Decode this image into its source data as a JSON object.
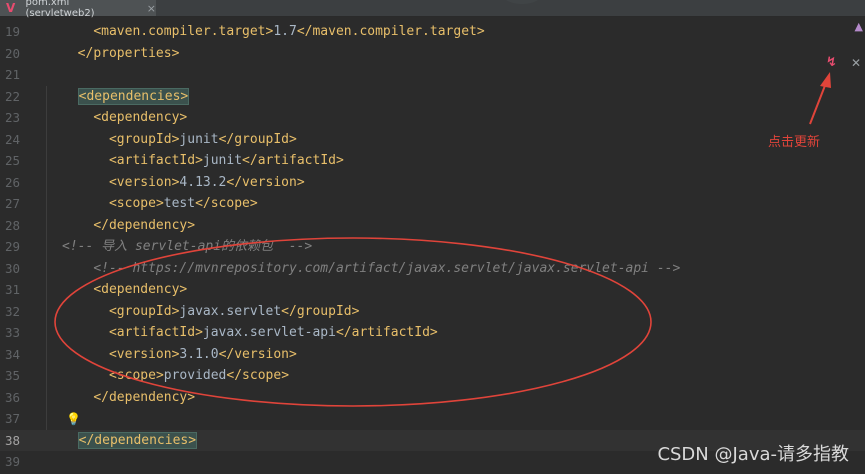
{
  "tab": {
    "title": "pom.xml (servletweb2)",
    "icon": "maven-icon",
    "close": "×"
  },
  "annotation": {
    "label": "点击更新"
  },
  "watermark": "CSDN @Java-请多指教",
  "current_line": 38,
  "lines": [
    {
      "num": "19",
      "parts": [
        {
          "t": "    "
        },
        {
          "c": "tag",
          "t": "<"
        },
        {
          "c": "tn",
          "t": "maven.compiler.target"
        },
        {
          "c": "tag",
          "t": ">"
        },
        {
          "c": "txt",
          "t": "1.7"
        },
        {
          "c": "tag",
          "t": "</"
        },
        {
          "c": "tn",
          "t": "maven.compiler.target"
        },
        {
          "c": "tag",
          "t": ">"
        }
      ]
    },
    {
      "num": "20",
      "parts": [
        {
          "t": "  "
        },
        {
          "c": "tag",
          "t": "</"
        },
        {
          "c": "tn",
          "t": "properties"
        },
        {
          "c": "tag",
          "t": ">"
        }
      ]
    },
    {
      "num": "21",
      "parts": []
    },
    {
      "num": "22",
      "parts": [
        {
          "t": "  "
        },
        {
          "c": "tag hl",
          "t": "<dependencies>"
        }
      ]
    },
    {
      "num": "23",
      "parts": [
        {
          "t": "    "
        },
        {
          "c": "tag",
          "t": "<"
        },
        {
          "c": "tn",
          "t": "dependency"
        },
        {
          "c": "tag",
          "t": ">"
        }
      ]
    },
    {
      "num": "24",
      "parts": [
        {
          "t": "      "
        },
        {
          "c": "tag",
          "t": "<"
        },
        {
          "c": "tn",
          "t": "groupId"
        },
        {
          "c": "tag",
          "t": ">"
        },
        {
          "c": "txt",
          "t": "junit"
        },
        {
          "c": "tag",
          "t": "</"
        },
        {
          "c": "tn",
          "t": "groupId"
        },
        {
          "c": "tag",
          "t": ">"
        }
      ]
    },
    {
      "num": "25",
      "parts": [
        {
          "t": "      "
        },
        {
          "c": "tag",
          "t": "<"
        },
        {
          "c": "tn",
          "t": "artifactId"
        },
        {
          "c": "tag",
          "t": ">"
        },
        {
          "c": "txt",
          "t": "junit"
        },
        {
          "c": "tag",
          "t": "</"
        },
        {
          "c": "tn",
          "t": "artifactId"
        },
        {
          "c": "tag",
          "t": ">"
        }
      ]
    },
    {
      "num": "26",
      "parts": [
        {
          "t": "      "
        },
        {
          "c": "tag",
          "t": "<"
        },
        {
          "c": "tn",
          "t": "version"
        },
        {
          "c": "tag",
          "t": ">"
        },
        {
          "c": "txt",
          "t": "4.13.2"
        },
        {
          "c": "tag",
          "t": "</"
        },
        {
          "c": "tn",
          "t": "version"
        },
        {
          "c": "tag",
          "t": ">"
        }
      ]
    },
    {
      "num": "27",
      "parts": [
        {
          "t": "      "
        },
        {
          "c": "tag",
          "t": "<"
        },
        {
          "c": "tn",
          "t": "scope"
        },
        {
          "c": "tag",
          "t": ">"
        },
        {
          "c": "txt",
          "t": "test"
        },
        {
          "c": "tag",
          "t": "</"
        },
        {
          "c": "tn",
          "t": "scope"
        },
        {
          "c": "tag",
          "t": ">"
        }
      ]
    },
    {
      "num": "28",
      "parts": [
        {
          "t": "    "
        },
        {
          "c": "tag",
          "t": "</"
        },
        {
          "c": "tn",
          "t": "dependency"
        },
        {
          "c": "tag",
          "t": ">"
        }
      ]
    },
    {
      "num": "29",
      "parts": [
        {
          "c": "cm",
          "t": "<!-- 导入 servlet-api的依赖包  -->"
        }
      ]
    },
    {
      "num": "30",
      "parts": [
        {
          "t": "    "
        },
        {
          "c": "cm",
          "t": "<!-- "
        },
        {
          "c": "cm",
          "u": true,
          "t": "https://mvnrepository.com/artifact/javax.servlet/javax.servlet-api"
        },
        {
          "c": "cm",
          "t": " -->"
        }
      ]
    },
    {
      "num": "31",
      "parts": [
        {
          "t": "    "
        },
        {
          "c": "tag",
          "t": "<"
        },
        {
          "c": "tn",
          "t": "dependency"
        },
        {
          "c": "tag",
          "t": ">"
        }
      ]
    },
    {
      "num": "32",
      "parts": [
        {
          "t": "      "
        },
        {
          "c": "tag",
          "t": "<"
        },
        {
          "c": "tn",
          "t": "groupId"
        },
        {
          "c": "tag",
          "t": ">"
        },
        {
          "c": "txt",
          "t": "javax.servlet"
        },
        {
          "c": "tag",
          "t": "</"
        },
        {
          "c": "tn",
          "t": "groupId"
        },
        {
          "c": "tag",
          "t": ">"
        }
      ]
    },
    {
      "num": "33",
      "parts": [
        {
          "t": "      "
        },
        {
          "c": "tag",
          "t": "<"
        },
        {
          "c": "tn",
          "t": "artifactId"
        },
        {
          "c": "tag",
          "t": ">"
        },
        {
          "c": "txt",
          "t": "javax.servlet-api"
        },
        {
          "c": "tag",
          "t": "</"
        },
        {
          "c": "tn",
          "t": "artifactId"
        },
        {
          "c": "tag",
          "t": ">"
        }
      ]
    },
    {
      "num": "34",
      "parts": [
        {
          "t": "      "
        },
        {
          "c": "tag",
          "t": "<"
        },
        {
          "c": "tn",
          "t": "version"
        },
        {
          "c": "tag",
          "t": ">"
        },
        {
          "c": "txt",
          "t": "3.1.0"
        },
        {
          "c": "tag",
          "t": "</"
        },
        {
          "c": "tn",
          "t": "version"
        },
        {
          "c": "tag",
          "t": ">"
        }
      ]
    },
    {
      "num": "35",
      "parts": [
        {
          "t": "      "
        },
        {
          "c": "tag",
          "t": "<"
        },
        {
          "c": "tn",
          "t": "scope"
        },
        {
          "c": "tag",
          "t": ">"
        },
        {
          "c": "txt",
          "t": "provided"
        },
        {
          "c": "tag",
          "t": "</"
        },
        {
          "c": "tn",
          "t": "scope"
        },
        {
          "c": "tag",
          "t": ">"
        }
      ]
    },
    {
      "num": "36",
      "parts": [
        {
          "t": "    "
        },
        {
          "c": "tag",
          "t": "</"
        },
        {
          "c": "tn",
          "t": "dependency"
        },
        {
          "c": "tag",
          "t": ">"
        }
      ]
    },
    {
      "num": "37",
      "parts": []
    },
    {
      "num": "38",
      "parts": [
        {
          "t": "  "
        },
        {
          "c": "tag hl",
          "t": "</dependencies>"
        }
      ]
    },
    {
      "num": "39",
      "parts": []
    }
  ],
  "colors": {
    "annotation": "#e0443a",
    "accent": "#e74c6f"
  }
}
